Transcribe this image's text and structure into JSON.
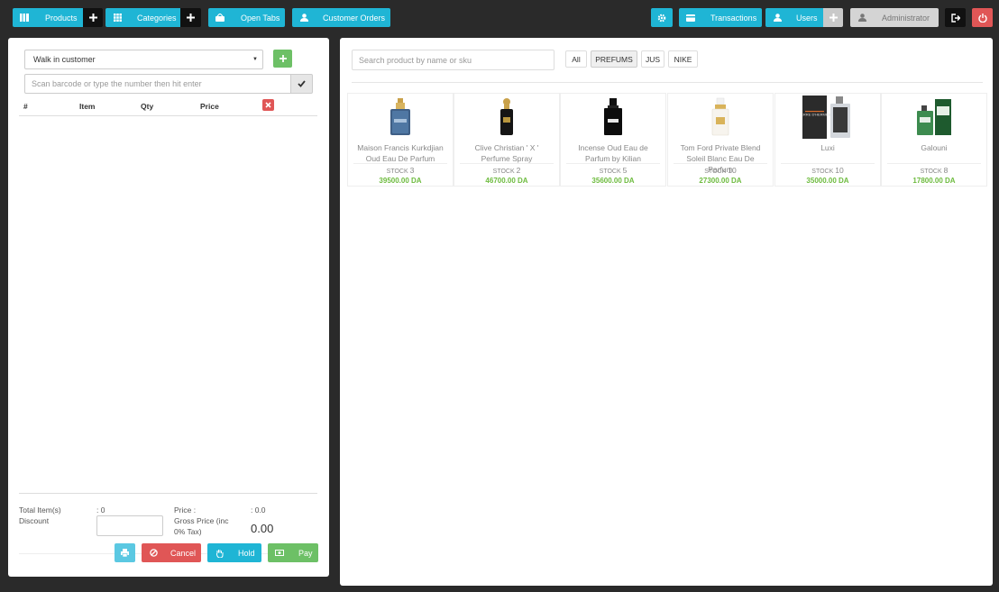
{
  "topbar": {
    "products_label": "Products",
    "categories_label": "Categories",
    "open_tabs_label": "Open Tabs",
    "customer_orders_label": "Customer Orders",
    "transactions_label": "Transactions",
    "users_label": "Users",
    "user_name": "Administrator"
  },
  "cart": {
    "customer_selected": "Walk in customer",
    "barcode_placeholder": "Scan barcode or type the number then hit enter",
    "columns": [
      "#",
      "Item",
      "Qty",
      "Price"
    ],
    "total_items_label": "Total Item(s)",
    "total_items_value": ": 0",
    "discount_label": "Discount",
    "price_label": "Price :",
    "price_value": ": 0.0",
    "gross_label_1": "Gross Price (inc",
    "gross_label_2": "0% Tax)",
    "gross_value": "0.00",
    "cancel_label": "Cancel",
    "hold_label": "Hold",
    "pay_label": "Pay"
  },
  "catalog": {
    "search_placeholder": "Search product by name or sku",
    "filters": [
      "All",
      "PREFUMS",
      "JUS",
      "NIKE"
    ],
    "active_filter": "PREFUMS",
    "products": [
      {
        "name_1": "Maison Francis Kurkdjian",
        "name_2": "Oud Eau De Parfum",
        "stock_label": "STOCK",
        "stock": "3",
        "price": "39500.00 DA"
      },
      {
        "name_1": "Clive Christian ' X '",
        "name_2": "Perfume Spray",
        "stock_label": "STOCK",
        "stock": "2",
        "price": "46700.00 DA"
      },
      {
        "name_1": "Incense Oud Eau de",
        "name_2": "Parfum by Kilian",
        "stock_label": "STOCK",
        "stock": "5",
        "price": "35600.00 DA"
      },
      {
        "name_1": "Tom Ford Private Blend",
        "name_2": "Soleil Blanc Eau De Parfum",
        "stock_label": "STOCK",
        "stock": "10",
        "price": "27300.00 DA"
      },
      {
        "name_1": "Luxi",
        "name_2": "",
        "stock_label": "STOCK",
        "stock": "10",
        "price": "35000.00 DA"
      },
      {
        "name_1": "Galouni",
        "name_2": "",
        "stock_label": "STOCK",
        "stock": "8",
        "price": "17800.00 DA"
      }
    ],
    "product_image_logo_text": "TERRE D'HERMES"
  },
  "colors": {
    "accent": "#1fb5d5",
    "danger": "#e05656",
    "success": "#6dc066",
    "price_green": "#6dbb3e",
    "background": "#2a2a2a"
  }
}
